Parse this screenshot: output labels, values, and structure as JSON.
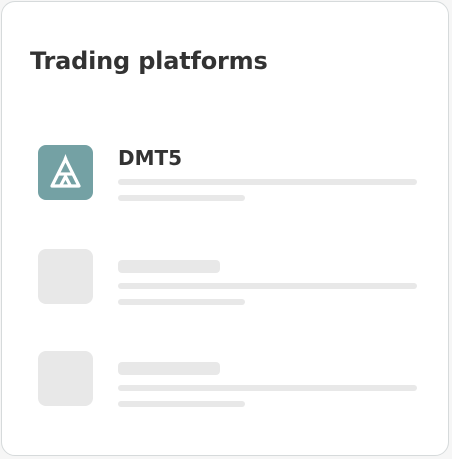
{
  "card": {
    "title": "Trading platforms"
  },
  "platforms": [
    {
      "name": "DMT5",
      "icon": "dmt5-logo-icon",
      "icon_bg": "#74a1a4"
    }
  ],
  "colors": {
    "card_border": "#d6dadb",
    "text": "#333333",
    "skeleton": "#e8e8e8"
  }
}
